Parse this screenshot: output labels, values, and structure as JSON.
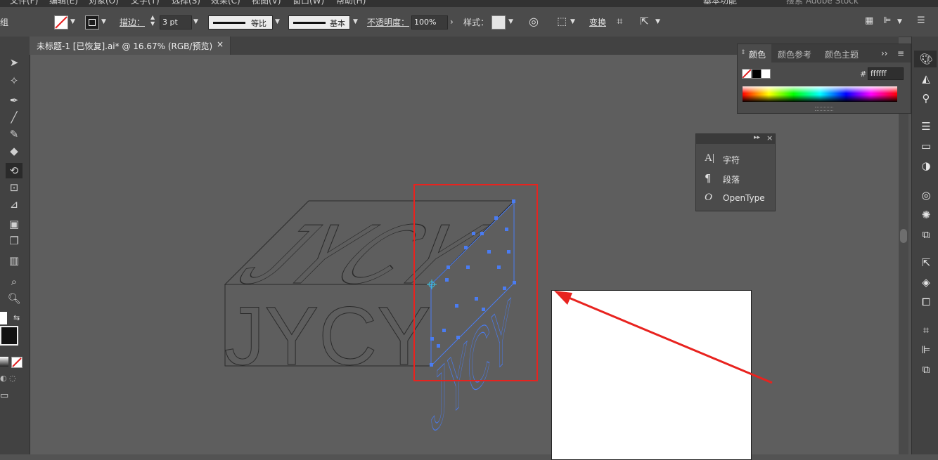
{
  "menu": {
    "items": [
      "文件(F)",
      "编辑(E)",
      "对象(O)",
      "文字(T)",
      "选择(S)",
      "效果(C)",
      "视图(V)",
      "窗口(W)",
      "帮助(H)"
    ],
    "workspace": "基本功能",
    "search_placeholder": "搜索 Adobe Stock"
  },
  "control_bar": {
    "left_cut_label": "组",
    "stroke_label": "描边：",
    "stroke_weight": "3 pt",
    "profile_label": "等比",
    "brush_label": "基本",
    "opacity_label": "不透明度：",
    "opacity_value": "100%",
    "style_label": "样式：",
    "transform_label": "变换"
  },
  "document_tab": {
    "title": "未标题-1 [已恢复].ai* @ 16.67% (RGB/预览)",
    "close": "×"
  },
  "color_panel": {
    "tabs": [
      "颜色",
      "颜色参考",
      "颜色主题"
    ],
    "hash": "#",
    "hex_value": "ffffff",
    "more": "››"
  },
  "type_panel": {
    "items": [
      {
        "icon": "character-icon",
        "label": "字符"
      },
      {
        "icon": "paragraph-icon",
        "label": "段落"
      },
      {
        "icon": "opentype-icon",
        "label": "OpenType"
      }
    ]
  },
  "artwork": {
    "front_text": "JYCY",
    "top_text": "JYCY",
    "side_text": "JYCY"
  },
  "colors": {
    "highlight_red": "#e8231f",
    "selection_blue": "#4a7cf2",
    "canvas": "#5e5e5e"
  }
}
